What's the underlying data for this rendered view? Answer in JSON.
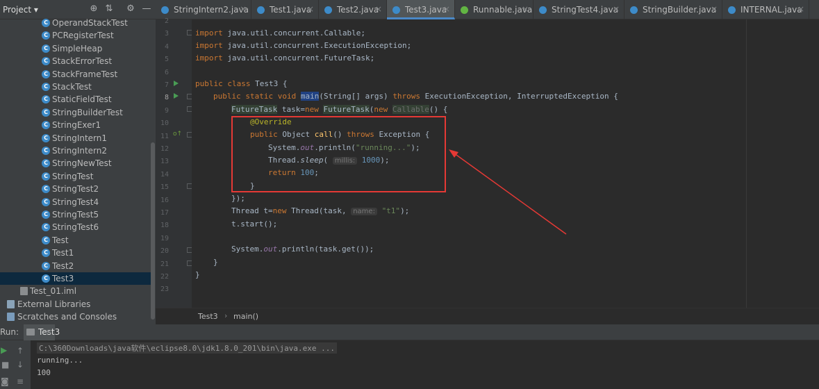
{
  "project_panel": {
    "title": "Project ▾"
  },
  "tree_items": [
    {
      "label": "OperandStackTest",
      "type": "class"
    },
    {
      "label": "PCRegisterTest",
      "type": "class"
    },
    {
      "label": "SimpleHeap",
      "type": "class"
    },
    {
      "label": "StackErrorTest",
      "type": "class"
    },
    {
      "label": "StackFrameTest",
      "type": "class"
    },
    {
      "label": "StackTest",
      "type": "class"
    },
    {
      "label": "StaticFieldTest",
      "type": "class"
    },
    {
      "label": "StringBuilderTest",
      "type": "class"
    },
    {
      "label": "StringExer1",
      "type": "class"
    },
    {
      "label": "StringIntern1",
      "type": "class"
    },
    {
      "label": "StringIntern2",
      "type": "class"
    },
    {
      "label": "StringNewTest",
      "type": "class"
    },
    {
      "label": "StringTest",
      "type": "class"
    },
    {
      "label": "StringTest2",
      "type": "class"
    },
    {
      "label": "StringTest4",
      "type": "class"
    },
    {
      "label": "StringTest5",
      "type": "class"
    },
    {
      "label": "StringTest6",
      "type": "class"
    },
    {
      "label": "Test",
      "type": "class"
    },
    {
      "label": "Test1",
      "type": "class"
    },
    {
      "label": "Test2",
      "type": "class"
    },
    {
      "label": "Test3",
      "type": "class",
      "selected": true
    },
    {
      "label": "Test_01.iml",
      "type": "file"
    },
    {
      "label": "External Libraries",
      "type": "lib"
    },
    {
      "label": "Scratches and Consoles",
      "type": "scratch"
    }
  ],
  "tabs": [
    {
      "label": "StringIntern2.java",
      "active": false,
      "icon": "class-icon"
    },
    {
      "label": "Test1.java",
      "active": false,
      "icon": "class-icon"
    },
    {
      "label": "Test2.java",
      "active": false,
      "icon": "class-icon"
    },
    {
      "label": "Test3.java",
      "active": true,
      "icon": "class-icon"
    },
    {
      "label": "Runnable.java",
      "active": false,
      "icon": "interface-icon"
    },
    {
      "label": "StringTest4.java",
      "active": false,
      "icon": "class-icon"
    },
    {
      "label": "StringBuilder.java",
      "active": false,
      "icon": "class-icon"
    },
    {
      "label": "INTERNAL.java",
      "active": false,
      "icon": "class-icon"
    }
  ],
  "line_numbers": [
    "2",
    "3",
    "4",
    "5",
    "6",
    "7",
    "8",
    "9",
    "10",
    "11",
    "12",
    "13",
    "14",
    "15",
    "16",
    "17",
    "18",
    "19",
    "20",
    "21",
    "22",
    "23"
  ],
  "code": {
    "l3": {
      "kw": "import",
      "rest": " java.util.concurrent.Callable;"
    },
    "l4": {
      "kw": "import",
      "rest": " java.util.concurrent.ExecutionException;"
    },
    "l5": {
      "kw": "import",
      "rest": " java.util.concurrent.FutureTask;"
    },
    "l7_kw": "public class",
    "l7_rest": " Test3 {",
    "l8_kw": "public static void",
    "l8_main": "main",
    "l8_args": "(String[] args) ",
    "l8_throws": "throws",
    "l8_rest": " ExecutionException, InterruptedException {",
    "l9_type": "FutureTask",
    "l9_mid": " task=",
    "l9_new": "new",
    "l9_type2": "FutureTask",
    "l9_mid2": "(",
    "l9_new2": "new",
    "l9_callable": "Callable",
    "l9_end": "() {",
    "l10_ann": "@Override",
    "l11_kw": "public",
    "l11_obj": " Object ",
    "l11_fn": "call",
    "l11_mid": "() ",
    "l11_throws": "throws",
    "l11_rest": " Exception {",
    "l12_a": "System.",
    "l12_out": "out",
    "l12_b": ".println(",
    "l12_str": "\"running...\"",
    "l12_c": ");",
    "l13_a": "Thread.",
    "l13_sleep": "sleep",
    "l13_b": "(",
    "l13_hint": "millis:",
    "l13_num": "1000",
    "l13_c": ");",
    "l14_kw": "return",
    "l14_num": "100",
    "l14_end": ";",
    "l15": "}",
    "l16": "});",
    "l17_a": "Thread t=",
    "l17_new": "new",
    "l17_b": " Thread(task,",
    "l17_hint": "name:",
    "l17_str": "\"t1\"",
    "l17_c": ");",
    "l18": "t.start();",
    "l20_a": "System.",
    "l20_out": "out",
    "l20_b": ".println(task.get());",
    "l21": "}",
    "l22": "}"
  },
  "breadcrumb": {
    "class": "Test3",
    "method": "main()"
  },
  "run": {
    "label": "Run:",
    "tab": "Test3",
    "cmd": "C:\\360Downloads\\java软件\\eclipse8.0\\jdk1.8.0_201\\bin\\java.exe ...",
    "lines": [
      "running...",
      "100"
    ]
  },
  "colors": {
    "annotation_box": "#e53935",
    "arrow": "#e53935",
    "accent": "#4a88c7"
  }
}
